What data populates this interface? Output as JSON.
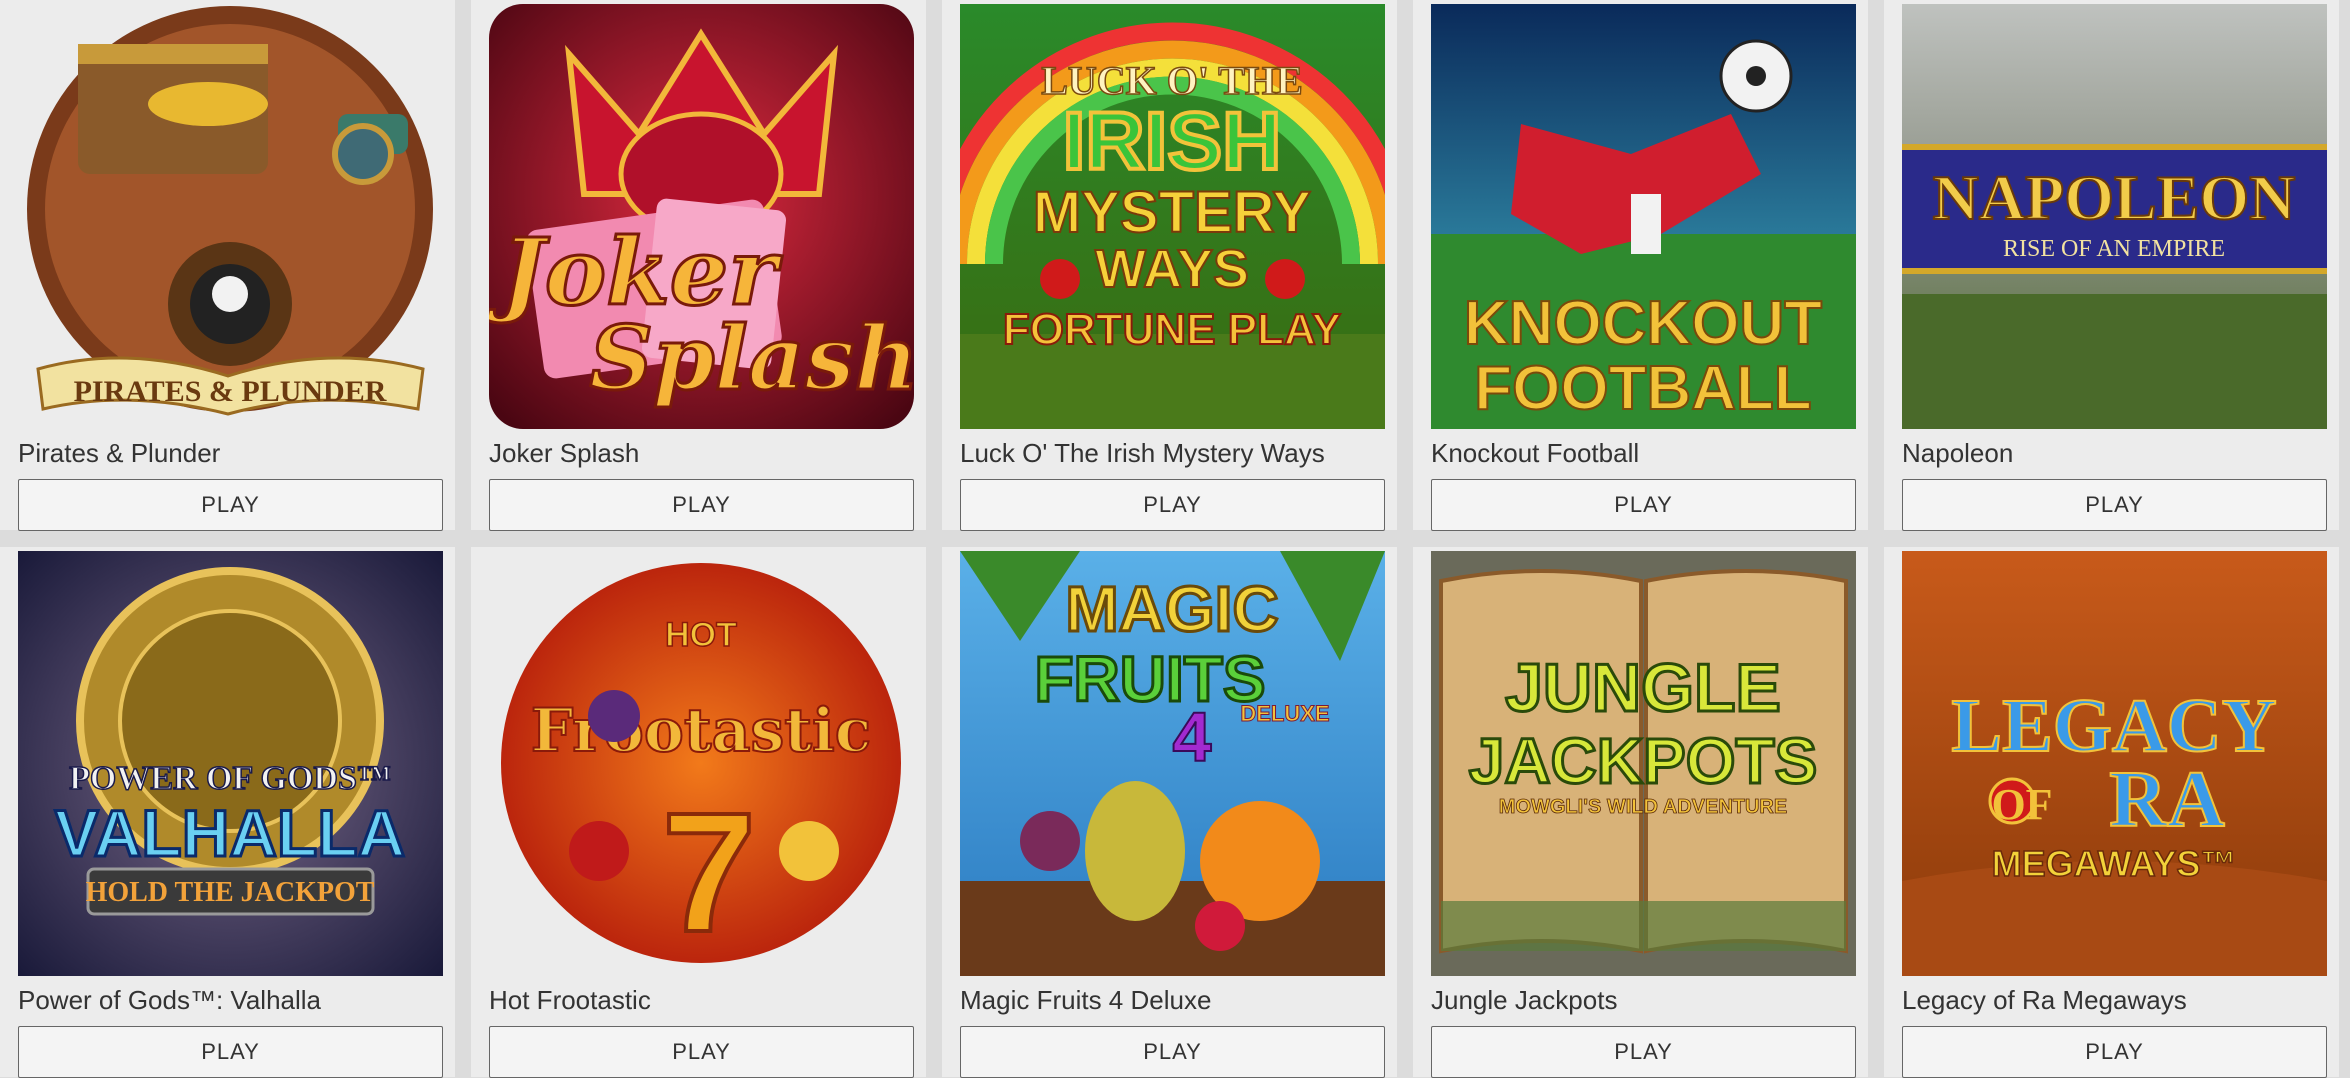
{
  "games": [
    {
      "title": "Pirates & Plunder",
      "play_label": "PLAY",
      "art_text": [
        "PIRATES",
        "&",
        "PLUNDER"
      ]
    },
    {
      "title": "Joker Splash",
      "play_label": "PLAY",
      "art_text": [
        "Joker",
        "Splash"
      ]
    },
    {
      "title": "Luck O' The Irish Mystery Ways",
      "play_label": "PLAY",
      "art_text": [
        "LUCK O' THE",
        "IRISH",
        "MYSTERY",
        "WAYS",
        "FORTUNE PLAY"
      ]
    },
    {
      "title": "Knockout Football",
      "play_label": "PLAY",
      "art_text": [
        "KNOCKOUT",
        "FOOTBALL"
      ]
    },
    {
      "title": "Napoleon",
      "play_label": "PLAY",
      "art_text": [
        "NAPOLEON",
        "RISE OF AN EMPIRE"
      ]
    },
    {
      "title": "Power of Gods™: Valhalla",
      "play_label": "PLAY",
      "art_text": [
        "POWER OF GODS™",
        "VALHALLA",
        "HOLD THE JACKPOT"
      ]
    },
    {
      "title": "Hot Frootastic",
      "play_label": "PLAY",
      "art_text": [
        "HOT",
        "Frootastic",
        "7"
      ]
    },
    {
      "title": "Magic Fruits 4 Deluxe",
      "play_label": "PLAY",
      "art_text": [
        "MAGIC",
        "FRUITS",
        "4",
        "DELUXE"
      ]
    },
    {
      "title": "Jungle Jackpots",
      "play_label": "PLAY",
      "art_text": [
        "JUNGLE",
        "JACKPOTS",
        "MOWGLI'S WILD ADVENTURE"
      ]
    },
    {
      "title": "Legacy of Ra Megaways",
      "play_label": "PLAY",
      "art_text": [
        "LEGACY",
        "OF",
        "RA",
        "MEGAWAYS™"
      ]
    }
  ]
}
